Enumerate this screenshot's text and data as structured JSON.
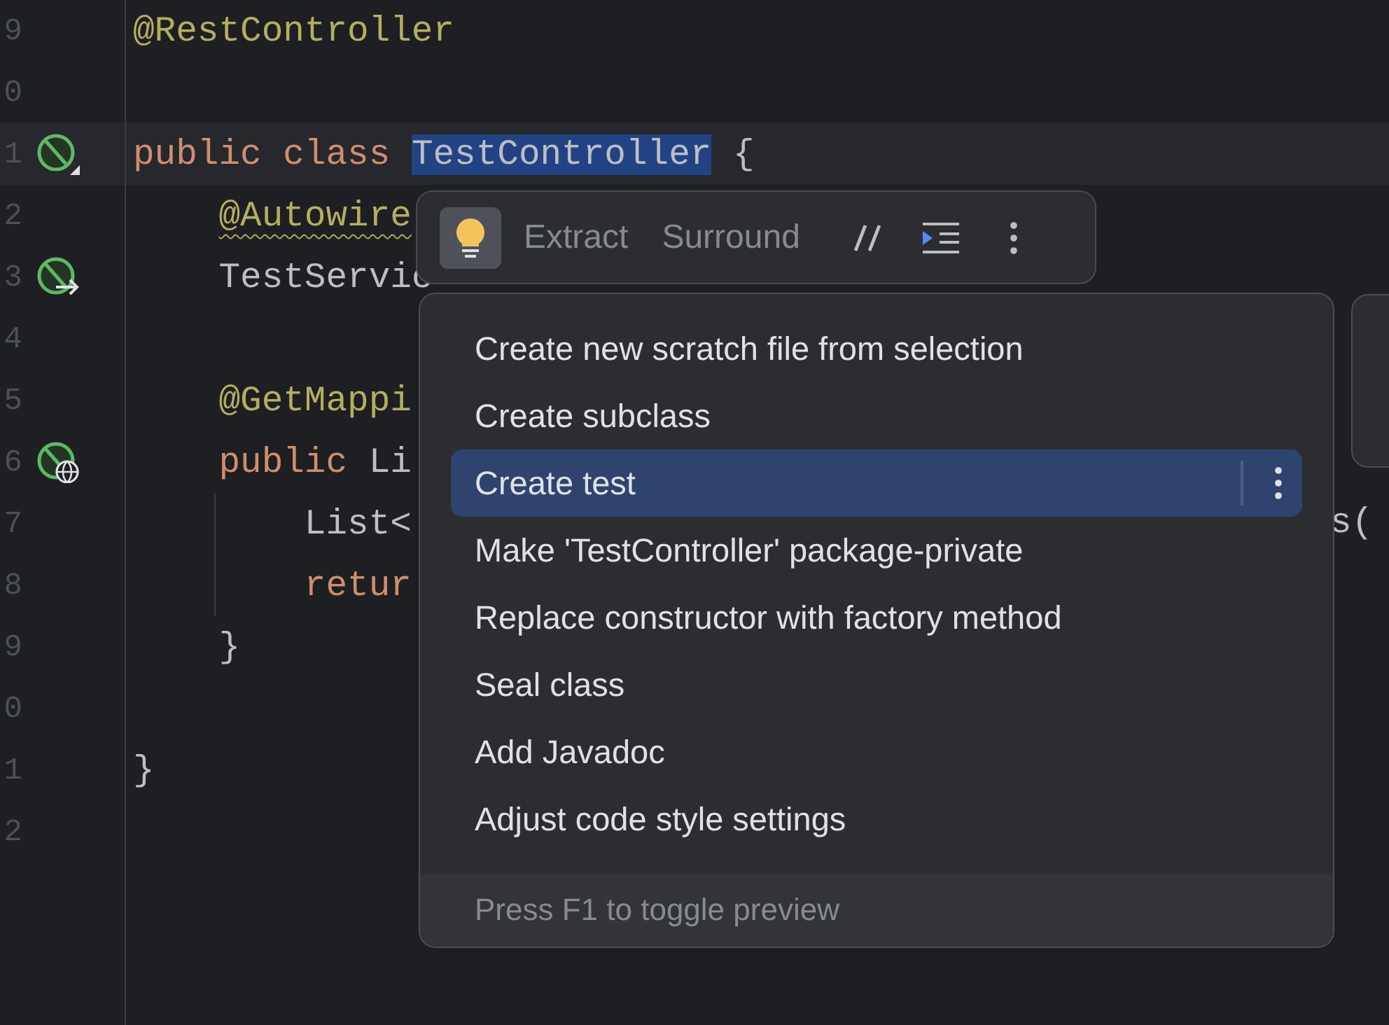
{
  "editor": {
    "lines": [
      {
        "number": "9",
        "kind": "plain",
        "current": false,
        "tokens": [
          {
            "kind": "annotation",
            "text": "@RestController",
            "warning": false
          }
        ]
      },
      {
        "number": "0",
        "kind": "plain",
        "current": false
      },
      {
        "number": "1",
        "kind": "class",
        "current": true,
        "tokens": [
          {
            "kind": "keyword",
            "text": "public class ",
            "warning": false
          },
          {
            "kind": "selected",
            "text": "TestController",
            "warning": false
          },
          {
            "kind": "plain",
            "text": " {",
            "warning": false
          }
        ]
      },
      {
        "number": "2",
        "kind": "plain",
        "current": false,
        "tokens": [
          {
            "kind": "annotation",
            "text": "    @Autowire",
            "warning": true
          }
        ]
      },
      {
        "number": "3",
        "kind": "autowired",
        "current": false,
        "tokens": [
          {
            "kind": "plain",
            "text": "    TestServic",
            "warning": false
          }
        ]
      },
      {
        "number": "4",
        "kind": "plain",
        "current": false
      },
      {
        "number": "5",
        "kind": "plain",
        "current": false,
        "tokens": [
          {
            "kind": "annotation",
            "text": "    @GetMappi",
            "warning": false
          }
        ]
      },
      {
        "number": "6",
        "kind": "endpoint",
        "current": false,
        "tokens": [
          {
            "kind": "keyword",
            "text": "    public ",
            "warning": false
          },
          {
            "kind": "plain",
            "text": "Li",
            "warning": false
          }
        ]
      },
      {
        "number": "7",
        "kind": "plain",
        "current": false,
        "tokens": [
          {
            "kind": "plain",
            "text": "        List<",
            "warning": false
          }
        ]
      },
      {
        "number": "8",
        "kind": "plain",
        "current": false,
        "tokens": [
          {
            "kind": "keyword",
            "text": "        retur",
            "warning": false
          }
        ]
      },
      {
        "number": "9",
        "kind": "plain",
        "current": false,
        "tokens": [
          {
            "kind": "plain",
            "text": "    }",
            "warning": false
          }
        ]
      },
      {
        "number": "0",
        "kind": "plain",
        "current": false
      },
      {
        "number": "1",
        "kind": "plain",
        "current": false,
        "tokens": [
          {
            "kind": "plain",
            "text": "}",
            "warning": false
          }
        ]
      },
      {
        "number": "2",
        "kind": "plain",
        "current": false
      }
    ],
    "right_fragment": "s("
  },
  "toolbar": {
    "actions": [
      "Extract",
      "Surround"
    ]
  },
  "menu": {
    "items": [
      {
        "label": "Create new scratch file from selection",
        "selected": false
      },
      {
        "label": "Create subclass",
        "selected": false
      },
      {
        "label": "Create test",
        "selected": true
      },
      {
        "label": "Make 'TestController' package-private",
        "selected": false
      },
      {
        "label": "Replace constructor with factory method",
        "selected": false
      },
      {
        "label": "Seal class",
        "selected": false
      },
      {
        "label": "Add Javadoc",
        "selected": false
      },
      {
        "label": "Adjust code style settings",
        "selected": false
      }
    ],
    "footer": "Press F1 to toggle preview"
  }
}
